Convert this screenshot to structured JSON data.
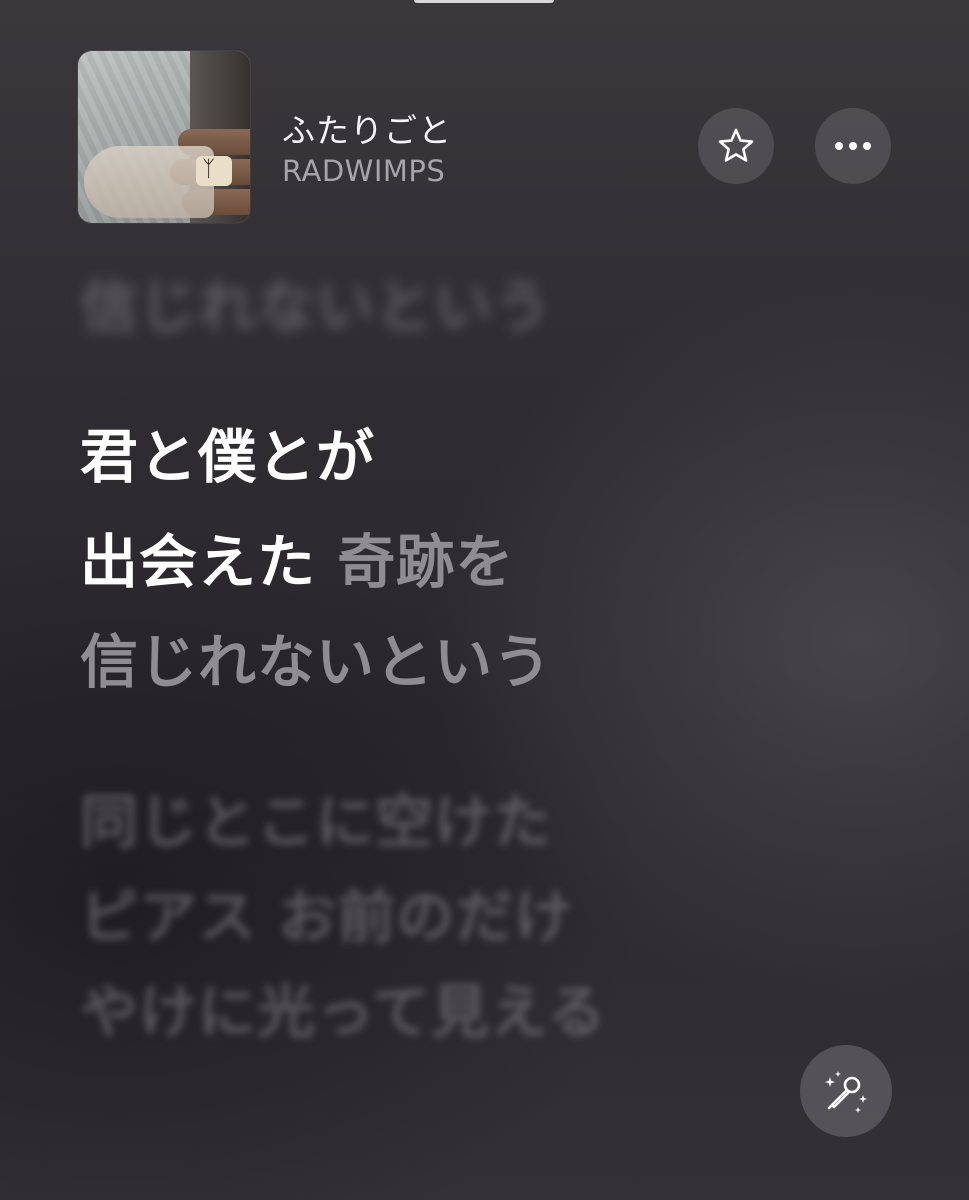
{
  "now_playing": {
    "title": "ふたりごと",
    "artist": "RADWIMPS",
    "artwork_icon": "album-art-hands-ring"
  },
  "controls": {
    "favorite_icon": "star-icon",
    "more_icon": "ellipsis-icon",
    "sing_icon": "microphone-sparkles-icon"
  },
  "lyrics": {
    "previous_line": "信じれないという",
    "current": {
      "line1": "君と僕とが",
      "line2_sung": "出会えた",
      "line2_unsung": "奇跡を",
      "line3": "信じれないという"
    },
    "upcoming": [
      "同じとこに空けた",
      "ピアス お前のだけ",
      "やけに光って見える"
    ]
  },
  "colors": {
    "background": "#2f2d30",
    "active_lyric": "#ffffff",
    "inactive_lyric": "#8f8d92",
    "artist_text": "#a7a5a9"
  }
}
